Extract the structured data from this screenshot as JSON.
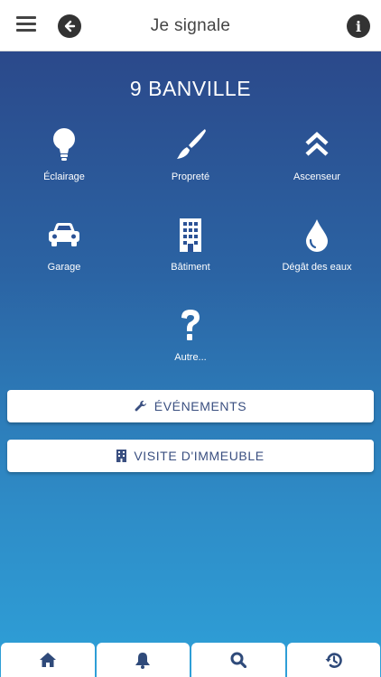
{
  "header": {
    "title": "Je signale",
    "menu_icon": "hamburger-icon",
    "back_icon": "arrow-left-icon",
    "info_icon": "info-icon"
  },
  "building": {
    "name": "9 BANVILLE"
  },
  "categories": [
    {
      "label": "Éclairage",
      "icon": "lightbulb-icon"
    },
    {
      "label": "Propreté",
      "icon": "paintbrush-icon"
    },
    {
      "label": "Ascenseur",
      "icon": "double-chevron-up-icon"
    },
    {
      "label": "Garage",
      "icon": "car-icon"
    },
    {
      "label": "Bâtiment",
      "icon": "building-icon"
    },
    {
      "label": "Dégât des eaux",
      "icon": "water-drop-icon"
    },
    {
      "label": "Autre...",
      "icon": "question-icon"
    }
  ],
  "actions": {
    "events_label": "ÉVÉNEMENTS",
    "visit_label": "VISITE D'IMMEUBLE"
  },
  "tabbar": [
    "home-icon",
    "bell-icon",
    "search-icon",
    "history-icon"
  ],
  "colors": {
    "accent": "#3a4f80",
    "gradient_top": "#2b4385",
    "gradient_bottom": "#2ea0d8"
  }
}
